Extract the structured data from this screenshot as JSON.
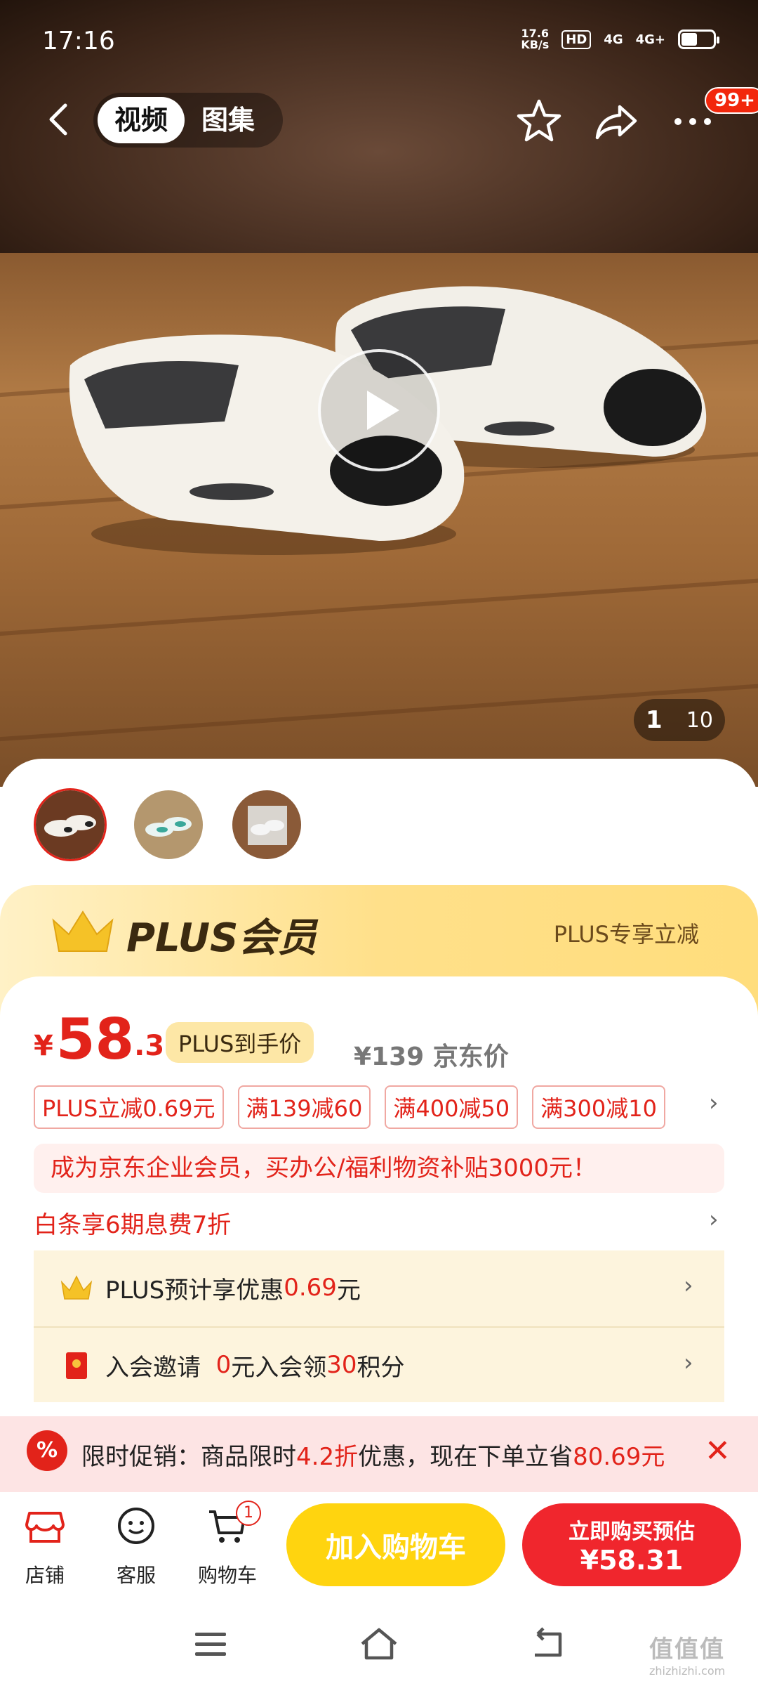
{
  "status_bar": {
    "time": "17:16",
    "net_speed_value": "17.6",
    "net_speed_unit": "KB/s",
    "hd": "HD",
    "signal1": "4G",
    "signal2": "4G+"
  },
  "topbar": {
    "tabs": [
      {
        "label": "视频",
        "active": true
      },
      {
        "label": "图集",
        "active": false
      }
    ],
    "badge": "99+"
  },
  "media": {
    "current": "1",
    "total": "10"
  },
  "thumbnails": [
    {
      "name": "white-slides"
    },
    {
      "name": "green-slides"
    },
    {
      "name": "grey-slides"
    }
  ],
  "plus_banner": {
    "title": "PLUS会员",
    "right_text": "PLUS专享立减"
  },
  "price": {
    "currency": "¥",
    "integer": "58",
    "decimal": ".31",
    "plus_tag": "PLUS到手价",
    "original": "¥139 京东价"
  },
  "coupons": [
    "PLUS立减0.69元",
    "满139减60",
    "满400减50",
    "满300减10"
  ],
  "enterprise_banner": "成为京东企业会员，买办公/福利物资补贴3000元！",
  "baitiao": "白条享6期息费7折",
  "benefits": {
    "plus": {
      "prefix": "PLUS预计享优惠",
      "amount": "0.69",
      "suffix": "元"
    },
    "invite": {
      "prefix": "入会邀请  ",
      "zero": "0",
      "middle": "元入会领",
      "points": "30",
      "suffix": "积分"
    }
  },
  "promo": {
    "badge": "%",
    "prefix": "限时促销：商品限时",
    "discount": "4.2折",
    "middle": "优惠，现在下单立省",
    "saving": "80.69元"
  },
  "bottom_nav": {
    "store": "店铺",
    "service": "客服",
    "cart": "购物车",
    "cart_count": "1",
    "add_to_cart": "加入购物车",
    "buy_now_line1": "立即购买预估",
    "buy_now_line2": "¥58.31"
  },
  "watermark": {
    "main": "值值值",
    "sub": "zhizhizhi.com"
  },
  "colors": {
    "accent_red": "#e2231a",
    "cart_yellow": "#ffd40f",
    "buy_red": "#f0262d",
    "plus_gold": "#ffe08a"
  }
}
